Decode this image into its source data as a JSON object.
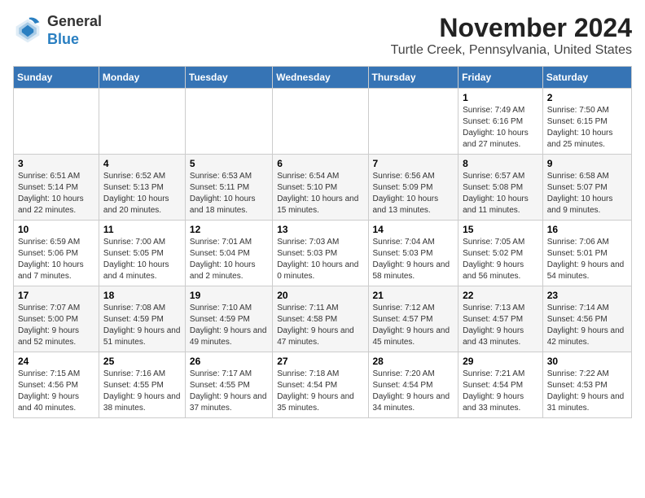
{
  "logo": {
    "line1": "General",
    "line2": "Blue"
  },
  "title": "November 2024",
  "subtitle": "Turtle Creek, Pennsylvania, United States",
  "days_of_week": [
    "Sunday",
    "Monday",
    "Tuesday",
    "Wednesday",
    "Thursday",
    "Friday",
    "Saturday"
  ],
  "weeks": [
    [
      {
        "day": "",
        "info": ""
      },
      {
        "day": "",
        "info": ""
      },
      {
        "day": "",
        "info": ""
      },
      {
        "day": "",
        "info": ""
      },
      {
        "day": "",
        "info": ""
      },
      {
        "day": "1",
        "info": "Sunrise: 7:49 AM\nSunset: 6:16 PM\nDaylight: 10 hours and 27 minutes."
      },
      {
        "day": "2",
        "info": "Sunrise: 7:50 AM\nSunset: 6:15 PM\nDaylight: 10 hours and 25 minutes."
      }
    ],
    [
      {
        "day": "3",
        "info": "Sunrise: 6:51 AM\nSunset: 5:14 PM\nDaylight: 10 hours and 22 minutes."
      },
      {
        "day": "4",
        "info": "Sunrise: 6:52 AM\nSunset: 5:13 PM\nDaylight: 10 hours and 20 minutes."
      },
      {
        "day": "5",
        "info": "Sunrise: 6:53 AM\nSunset: 5:11 PM\nDaylight: 10 hours and 18 minutes."
      },
      {
        "day": "6",
        "info": "Sunrise: 6:54 AM\nSunset: 5:10 PM\nDaylight: 10 hours and 15 minutes."
      },
      {
        "day": "7",
        "info": "Sunrise: 6:56 AM\nSunset: 5:09 PM\nDaylight: 10 hours and 13 minutes."
      },
      {
        "day": "8",
        "info": "Sunrise: 6:57 AM\nSunset: 5:08 PM\nDaylight: 10 hours and 11 minutes."
      },
      {
        "day": "9",
        "info": "Sunrise: 6:58 AM\nSunset: 5:07 PM\nDaylight: 10 hours and 9 minutes."
      }
    ],
    [
      {
        "day": "10",
        "info": "Sunrise: 6:59 AM\nSunset: 5:06 PM\nDaylight: 10 hours and 7 minutes."
      },
      {
        "day": "11",
        "info": "Sunrise: 7:00 AM\nSunset: 5:05 PM\nDaylight: 10 hours and 4 minutes."
      },
      {
        "day": "12",
        "info": "Sunrise: 7:01 AM\nSunset: 5:04 PM\nDaylight: 10 hours and 2 minutes."
      },
      {
        "day": "13",
        "info": "Sunrise: 7:03 AM\nSunset: 5:03 PM\nDaylight: 10 hours and 0 minutes."
      },
      {
        "day": "14",
        "info": "Sunrise: 7:04 AM\nSunset: 5:03 PM\nDaylight: 9 hours and 58 minutes."
      },
      {
        "day": "15",
        "info": "Sunrise: 7:05 AM\nSunset: 5:02 PM\nDaylight: 9 hours and 56 minutes."
      },
      {
        "day": "16",
        "info": "Sunrise: 7:06 AM\nSunset: 5:01 PM\nDaylight: 9 hours and 54 minutes."
      }
    ],
    [
      {
        "day": "17",
        "info": "Sunrise: 7:07 AM\nSunset: 5:00 PM\nDaylight: 9 hours and 52 minutes."
      },
      {
        "day": "18",
        "info": "Sunrise: 7:08 AM\nSunset: 4:59 PM\nDaylight: 9 hours and 51 minutes."
      },
      {
        "day": "19",
        "info": "Sunrise: 7:10 AM\nSunset: 4:59 PM\nDaylight: 9 hours and 49 minutes."
      },
      {
        "day": "20",
        "info": "Sunrise: 7:11 AM\nSunset: 4:58 PM\nDaylight: 9 hours and 47 minutes."
      },
      {
        "day": "21",
        "info": "Sunrise: 7:12 AM\nSunset: 4:57 PM\nDaylight: 9 hours and 45 minutes."
      },
      {
        "day": "22",
        "info": "Sunrise: 7:13 AM\nSunset: 4:57 PM\nDaylight: 9 hours and 43 minutes."
      },
      {
        "day": "23",
        "info": "Sunrise: 7:14 AM\nSunset: 4:56 PM\nDaylight: 9 hours and 42 minutes."
      }
    ],
    [
      {
        "day": "24",
        "info": "Sunrise: 7:15 AM\nSunset: 4:56 PM\nDaylight: 9 hours and 40 minutes."
      },
      {
        "day": "25",
        "info": "Sunrise: 7:16 AM\nSunset: 4:55 PM\nDaylight: 9 hours and 38 minutes."
      },
      {
        "day": "26",
        "info": "Sunrise: 7:17 AM\nSunset: 4:55 PM\nDaylight: 9 hours and 37 minutes."
      },
      {
        "day": "27",
        "info": "Sunrise: 7:18 AM\nSunset: 4:54 PM\nDaylight: 9 hours and 35 minutes."
      },
      {
        "day": "28",
        "info": "Sunrise: 7:20 AM\nSunset: 4:54 PM\nDaylight: 9 hours and 34 minutes."
      },
      {
        "day": "29",
        "info": "Sunrise: 7:21 AM\nSunset: 4:54 PM\nDaylight: 9 hours and 33 minutes."
      },
      {
        "day": "30",
        "info": "Sunrise: 7:22 AM\nSunset: 4:53 PM\nDaylight: 9 hours and 31 minutes."
      }
    ]
  ]
}
